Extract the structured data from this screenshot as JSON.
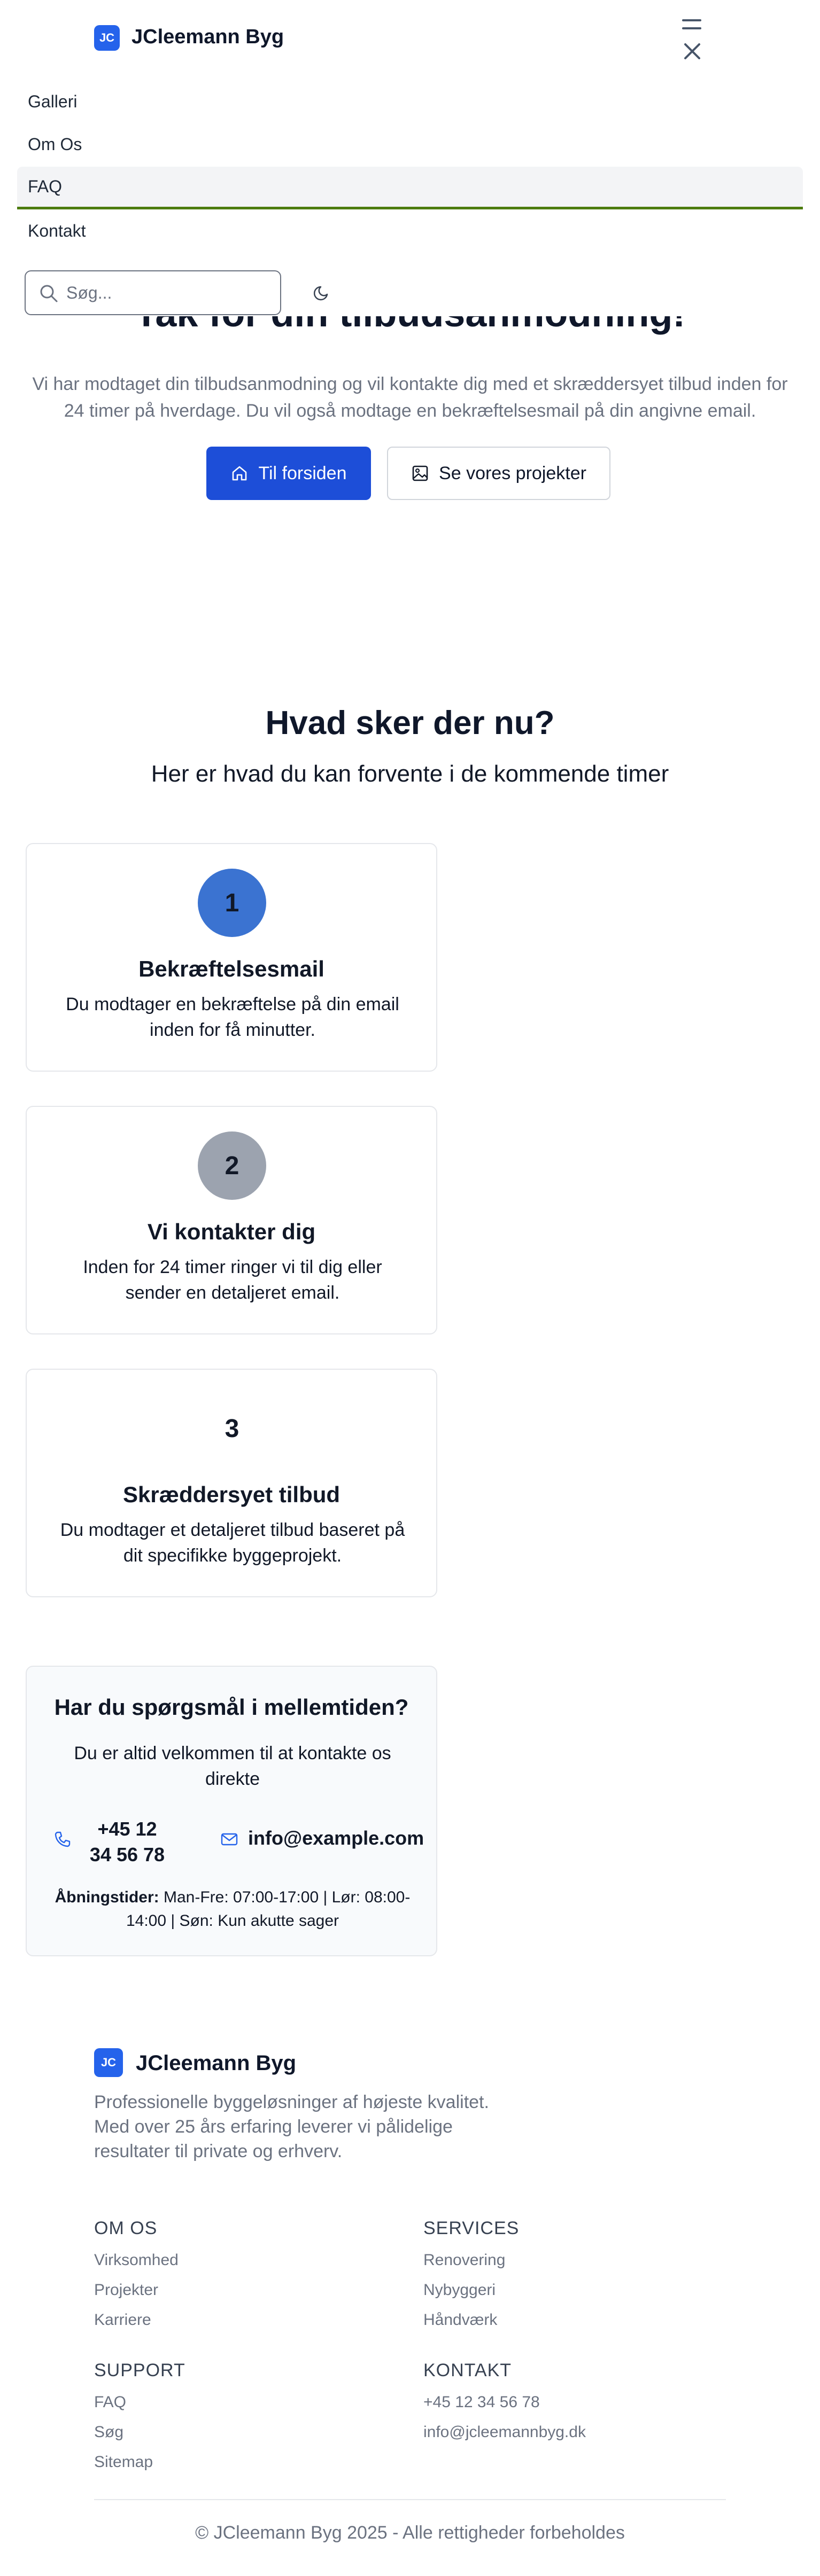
{
  "header": {
    "logo_initials": "JC",
    "brand_name": "JCleemann Byg"
  },
  "menu": {
    "items": [
      {
        "label": "Galleri"
      },
      {
        "label": "Om Os"
      },
      {
        "label": "FAQ"
      },
      {
        "label": "Kontakt"
      }
    ],
    "active": "FAQ"
  },
  "search": {
    "placeholder": "Søg..."
  },
  "hero": {
    "title": "Tak for din tilbudsanmodning!",
    "text": "Vi har modtaget din tilbudsanmodning og vil kontakte dig med et skræddersyet tilbud inden for 24 timer på hverdage. Du vil også modtage en bekræftelsesmail på din angivne email.",
    "primary_button": "Til forsiden",
    "secondary_button": "Se vores projekter"
  },
  "next_steps": {
    "title": "Hvad sker der nu?",
    "subtitle": "Her er hvad du kan forvente i de kommende timer",
    "steps": [
      {
        "number": "1",
        "title": "Bekræftelsesmail",
        "text": "Du modtager en bekræftelse på din email inden for få minutter.",
        "color": "#3b73d1"
      },
      {
        "number": "2",
        "title": "Vi kontakter dig",
        "text": "Inden for 24 timer ringer vi til dig eller sender en detaljeret email.",
        "color": "#9ca3af"
      },
      {
        "number": "3",
        "title": "Skræddersyet tilbud",
        "text": "Du modtager et detaljeret tilbud baseret på dit specifikke byggeprojekt.",
        "color": "#ffffff"
      }
    ]
  },
  "contact_box": {
    "title": "Har du spørgsmål i mellemtiden?",
    "text": "Du er altid velkommen til at kontakte os direkte",
    "phone": "+45 12 34 56 78",
    "email": "info@example.com",
    "hours_label": "Åbningstider:",
    "hours": "Man-Fre: 07:00-17:00 | Lør: 08:00-14:00 | Søn: Kun akutte sager"
  },
  "footer": {
    "logo_initials": "JC",
    "brand_name": "JCleemann Byg",
    "description": "Professionelle byggeløsninger af højeste kvalitet. Med over 25 års erfaring leverer vi pålidelige resultater til private og erhverv.",
    "columns": {
      "om_os": {
        "heading": "OM OS",
        "links": [
          "Virksomhed",
          "Projekter",
          "Karriere"
        ]
      },
      "services": {
        "heading": "SERVICES",
        "links": [
          "Renovering",
          "Nybyggeri",
          "Håndværk"
        ]
      },
      "support": {
        "heading": "SUPPORT",
        "links": [
          "FAQ",
          "Søg",
          "Sitemap"
        ]
      },
      "kontakt": {
        "heading": "KONTAKT",
        "links": [
          "+45 12 34 56 78",
          "info@jcleemannbyg.dk"
        ]
      }
    },
    "copyright": "© JCleemann Byg 2025 - Alle rettigheder forbeholdes"
  },
  "colors": {
    "accent": "#2563eb",
    "primary_button": "#1d4ed8",
    "active_underline": "#4d7c0f"
  }
}
